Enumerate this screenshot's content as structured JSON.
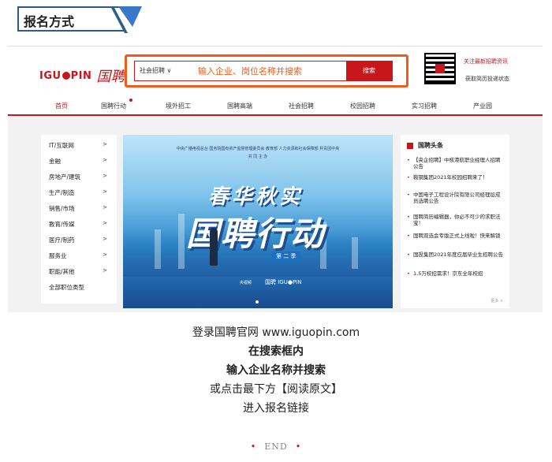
{
  "section": {
    "title": "报名方式"
  },
  "site": {
    "logo_latin_1": "IGU",
    "logo_latin_2": "PIN",
    "logo_cn": "国聘",
    "search": {
      "category": "社会招聘 ∨",
      "placeholder": "输入企业、岗位名称并搜索",
      "button": "搜索"
    },
    "follow_text": "关注最新招聘资讯",
    "follow_sub": "获取简历投递状态",
    "nav": [
      "首页",
      "国聘行动",
      "境外招工",
      "国聘高端",
      "社会招聘",
      "校园招聘",
      "实习招聘",
      "产业园"
    ],
    "categories": [
      "IT/互联网",
      "金融",
      "房地产/建筑",
      "生产/制造",
      "销售/市场",
      "教育/传媒",
      "医疗/制药",
      "服务业",
      "职能/其他",
      "全部职位类型"
    ],
    "banner": {
      "top_line": "中央广播电视总台   国务院国有资产监督管理委员会   教育部   人力资源和社会保障部   共青团中央",
      "sub_line": "共 同 主 办",
      "title1": "春华秋实",
      "title2": "国聘行动",
      "season": "第 二 季",
      "logo1": "央视频",
      "logo2": "国聘 IGU●PIN"
    },
    "news": {
      "title": "国聘头条",
      "items": [
        "【央企招聘】中核港航职业经理人招聘公告",
        "鞍钢集团2021年校园招聘来了！",
        "中国电子工程设计院有限公司经理层成员选聘公告",
        "国聘简历编辑器，你必不可少的求职法宝！",
        "国聘双选会专版正式上线啦！快来解锁",
        "国投集团2021年度应届毕业生招聘公告",
        "1.5万校招需求！京东全年校招"
      ],
      "more": "更多 >"
    }
  },
  "caption": {
    "line1": "登录国聘官网 www.iguopin.com",
    "line2": "在搜索框内",
    "line3": "输入企业名称并搜索",
    "line4": "或点击最下方【阅读原文】",
    "line5": "进入报名链接"
  },
  "end": "END",
  "colors": {
    "brand_red": "#c8161d",
    "highlight_orange": "#f05a1a",
    "header_blue": "#2f5d8a"
  }
}
